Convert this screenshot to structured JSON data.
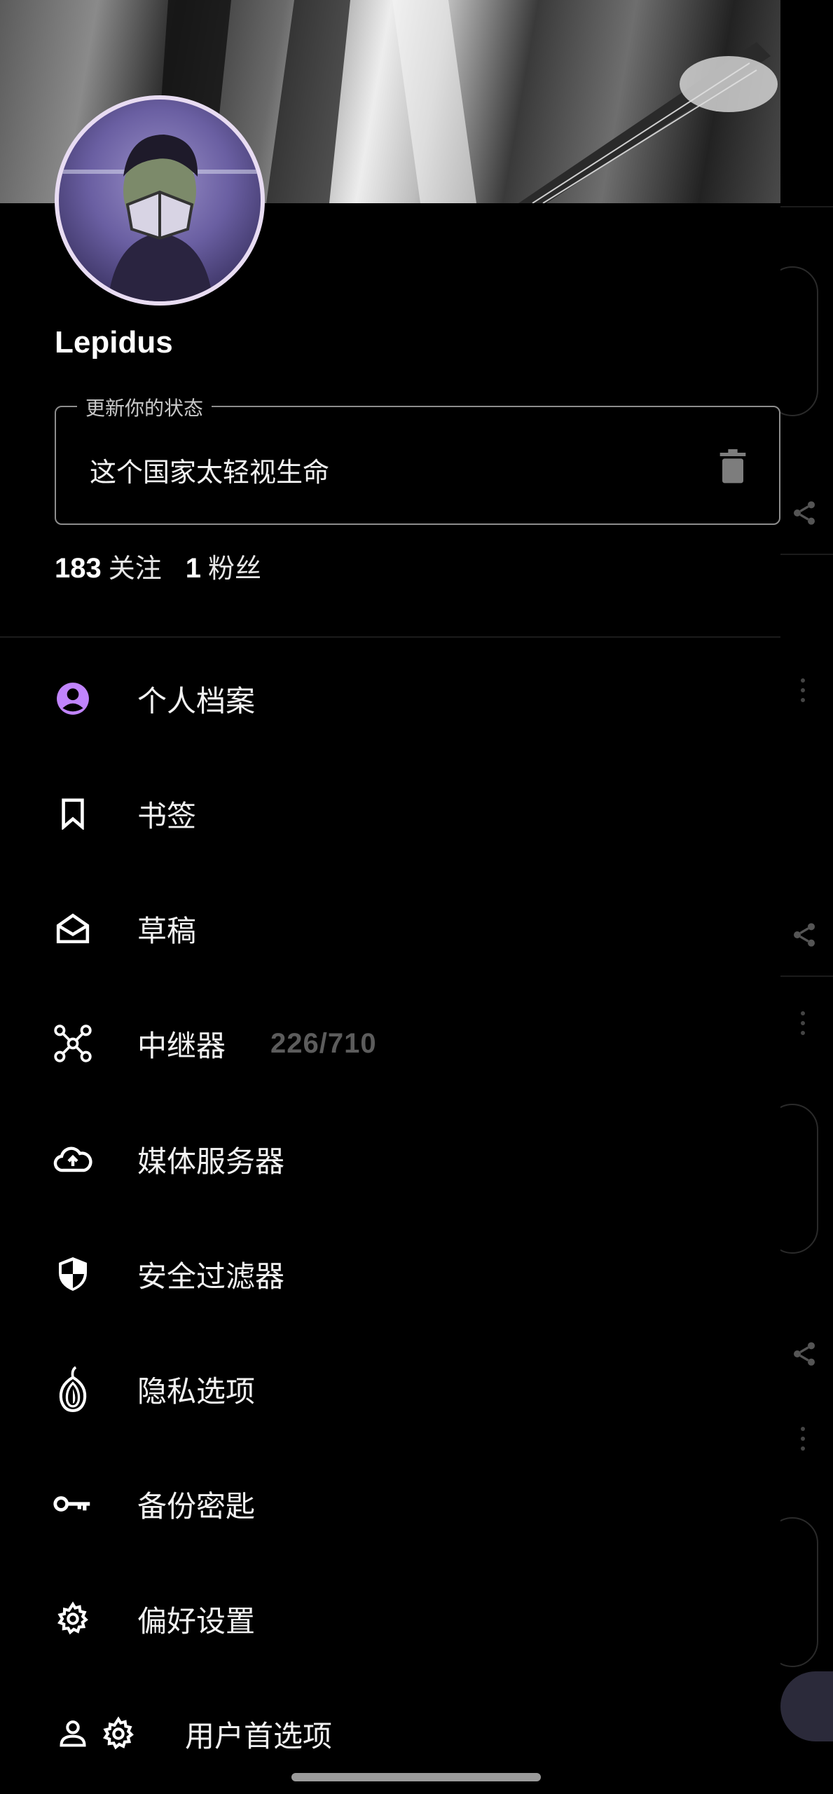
{
  "profile": {
    "display_name": "Lepidus",
    "status": {
      "legend": "更新你的状态",
      "value": "这个国家太轻视生命"
    },
    "following_count": "183",
    "following_label": "关注",
    "followers_count": "1",
    "followers_label": "粉丝"
  },
  "menu": {
    "items": [
      {
        "label": "个人档案",
        "icon": "account-circle-icon"
      },
      {
        "label": "书签",
        "icon": "bookmark-icon"
      },
      {
        "label": "草稿",
        "icon": "drafts-envelope-icon"
      },
      {
        "label": "中继器",
        "icon": "relays-hub-icon",
        "extra": "226/710"
      },
      {
        "label": "媒体服务器",
        "icon": "cloud-upload-icon"
      },
      {
        "label": "安全过滤器",
        "icon": "shield-icon"
      },
      {
        "label": "隐私选项",
        "icon": "tor-onion-icon"
      },
      {
        "label": "备份密匙",
        "icon": "key-icon"
      },
      {
        "label": "偏好设置",
        "icon": "gear-icon"
      },
      {
        "label": "用户首选项",
        "icon": "user-gear-icon"
      }
    ]
  },
  "colors": {
    "accent": "#c084fc",
    "background": "#000000",
    "text": "#f2f2f2",
    "muted": "#5c5c5c"
  }
}
